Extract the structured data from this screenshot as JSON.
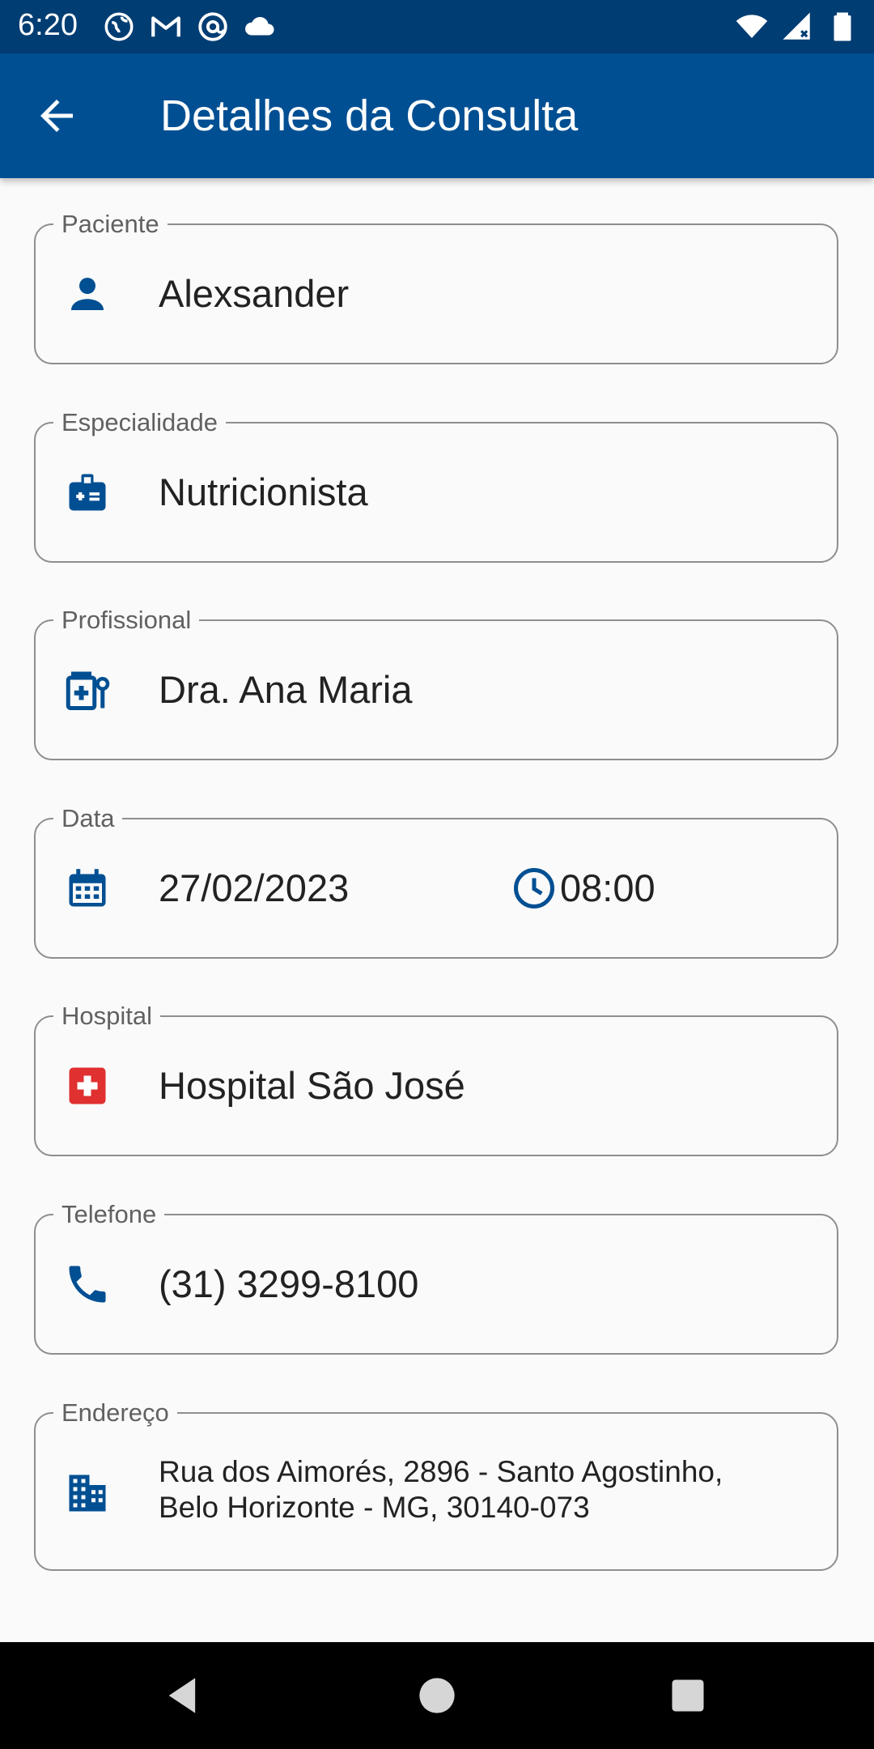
{
  "status_bar": {
    "time": "6:20",
    "left_icons": [
      "globe-icon",
      "gmail-icon",
      "at-sign-icon",
      "cloud-icon"
    ],
    "right_icons": [
      "wifi-icon",
      "signal-icon",
      "battery-icon"
    ]
  },
  "app_bar": {
    "title": "Detalhes da Consulta",
    "back_icon": "arrow-back-icon"
  },
  "fields": {
    "patient": {
      "label": "Paciente",
      "value": "Alexsander",
      "icon": "person-icon"
    },
    "specialty": {
      "label": "Especialidade",
      "value": "Nutricionista",
      "icon": "medical-badge-icon"
    },
    "professional": {
      "label": "Profissional",
      "value": "Dra. Ana Maria",
      "icon": "medical-services-icon"
    },
    "date": {
      "label": "Data",
      "date": "27/02/2023",
      "time": "08:00",
      "date_icon": "calendar-icon",
      "time_icon": "clock-icon"
    },
    "hospital": {
      "label": "Hospital",
      "value": "Hospital São José",
      "icon": "hospital-cross-icon"
    },
    "phone": {
      "label": "Telefone",
      "value": "(31) 3299-8100",
      "icon": "phone-icon"
    },
    "address": {
      "label": "Endereço",
      "line1": "Rua dos Aimorés, 2896 - Santo Agostinho,",
      "line2": "Belo Horizonte - MG, 30140-073",
      "icon": "apartment-icon"
    }
  },
  "nav_bar": {
    "buttons": [
      "back-triangle-icon",
      "home-circle-icon",
      "recents-square-icon"
    ]
  },
  "colors": {
    "status_bar": "#003d73",
    "app_bar": "#004f93",
    "icon_blue": "#004f93",
    "hospital_red": "#e03030",
    "field_border": "#8e8e8e",
    "background": "#fafafa"
  }
}
